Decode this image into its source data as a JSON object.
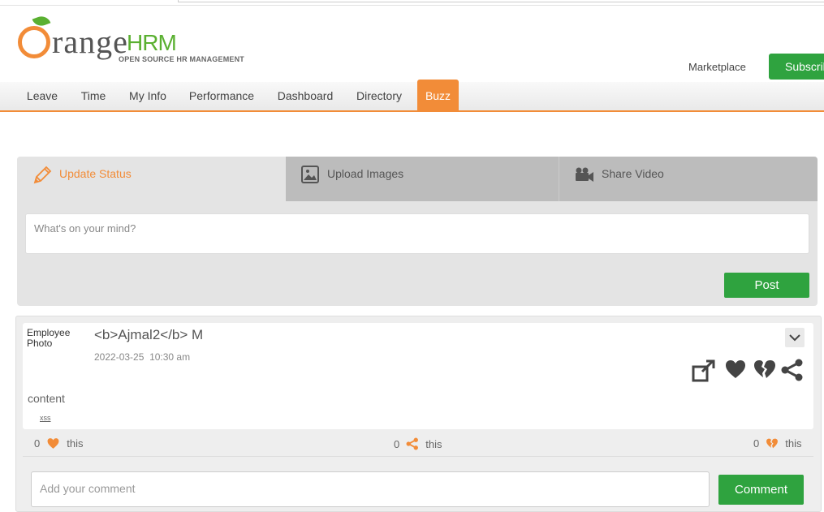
{
  "brand": {
    "wordmark": "range",
    "hrm": "HRM",
    "tagline": "OPEN SOURCE HR MANAGEMENT",
    "orange": "#f28c38",
    "green": "#5ab031"
  },
  "header": {
    "marketplace_label": "Marketplace",
    "subscribe_label": "Subscribe"
  },
  "nav": {
    "items": [
      {
        "label": "Leave"
      },
      {
        "label": "Time"
      },
      {
        "label": "My Info"
      },
      {
        "label": "Performance"
      },
      {
        "label": "Dashboard"
      },
      {
        "label": "Directory"
      },
      {
        "label": "Buzz",
        "active": true
      }
    ]
  },
  "composer": {
    "tabs": [
      {
        "label": "Update Status",
        "icon": "pencil-icon",
        "active": true
      },
      {
        "label": "Upload Images",
        "icon": "image-icon"
      },
      {
        "label": "Share Video",
        "icon": "video-camera-icon"
      }
    ],
    "placeholder": "What's on your mind?",
    "post_label": "Post"
  },
  "post": {
    "photo_alt": "Employee Photo",
    "author": "<b>Ajmal2</b> M",
    "date": "2022-03-25",
    "time": "10:30 am",
    "content": "content",
    "link": "xss",
    "actions": [
      "share-post-icon",
      "like-icon",
      "unlike-icon",
      "share-icon"
    ],
    "stats": {
      "likes": {
        "count": "0",
        "text": "this"
      },
      "shares": {
        "count": "0",
        "text": "this"
      },
      "unlikes": {
        "count": "0",
        "text": "this"
      }
    },
    "comment_placeholder": "Add your comment",
    "comment_label": "Comment"
  }
}
